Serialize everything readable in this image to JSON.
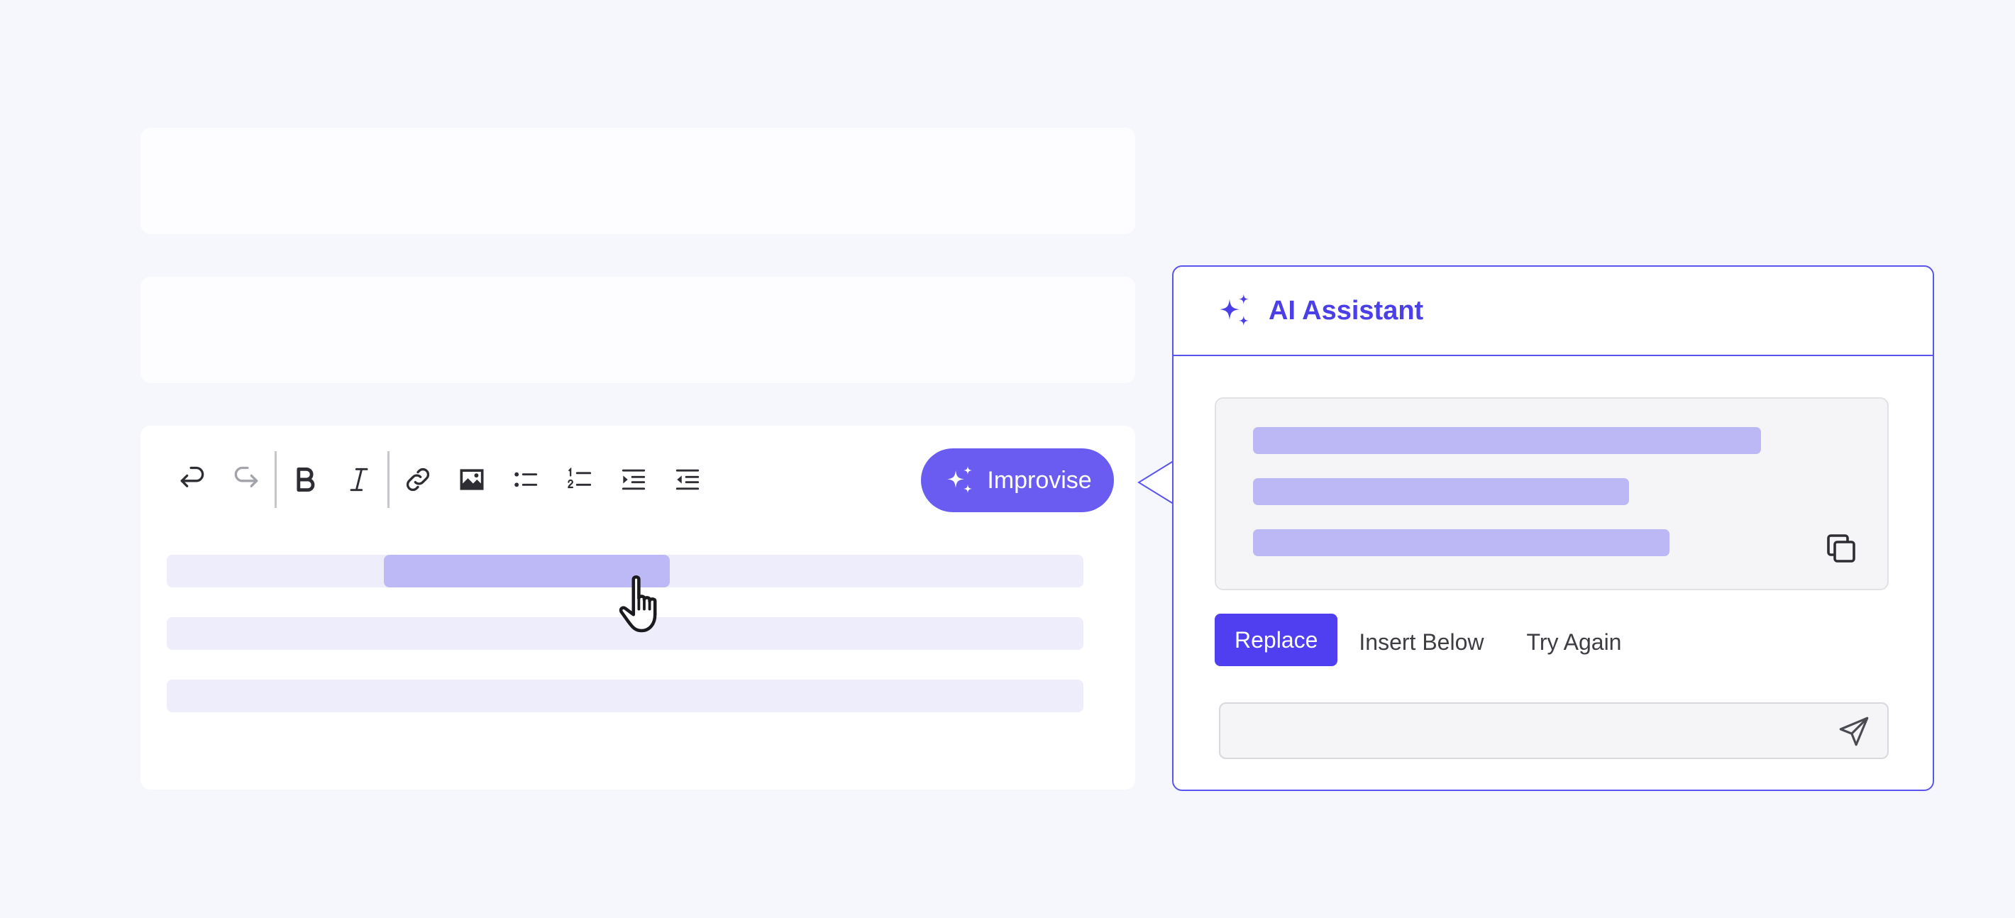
{
  "editor": {
    "toolbar": {
      "items": [
        {
          "name": "undo-icon",
          "disabled": false
        },
        {
          "name": "redo-icon",
          "disabled": true
        },
        {
          "name": "bold-icon",
          "disabled": false
        },
        {
          "name": "italic-icon",
          "disabled": false
        },
        {
          "name": "link-icon",
          "disabled": false
        },
        {
          "name": "image-icon",
          "disabled": false
        },
        {
          "name": "bullet-list-icon",
          "disabled": false
        },
        {
          "name": "numbered-list-icon",
          "disabled": false
        },
        {
          "name": "indent-icon",
          "disabled": false
        },
        {
          "name": "outdent-icon",
          "disabled": false
        }
      ]
    },
    "improvise_label": "Improvise"
  },
  "ai_panel": {
    "title": "AI Assistant",
    "actions": {
      "replace": "Replace",
      "insert_below": "Insert Below",
      "try_again": "Try Again"
    },
    "prompt": {
      "value": "",
      "placeholder": ""
    }
  },
  "colors": {
    "accent": "#4f3ff0",
    "improvise_bg": "#6a5cf0",
    "selection": "#bdb9f6",
    "placeholder_line": "#eeedfb",
    "background": "#f6f6fd"
  }
}
